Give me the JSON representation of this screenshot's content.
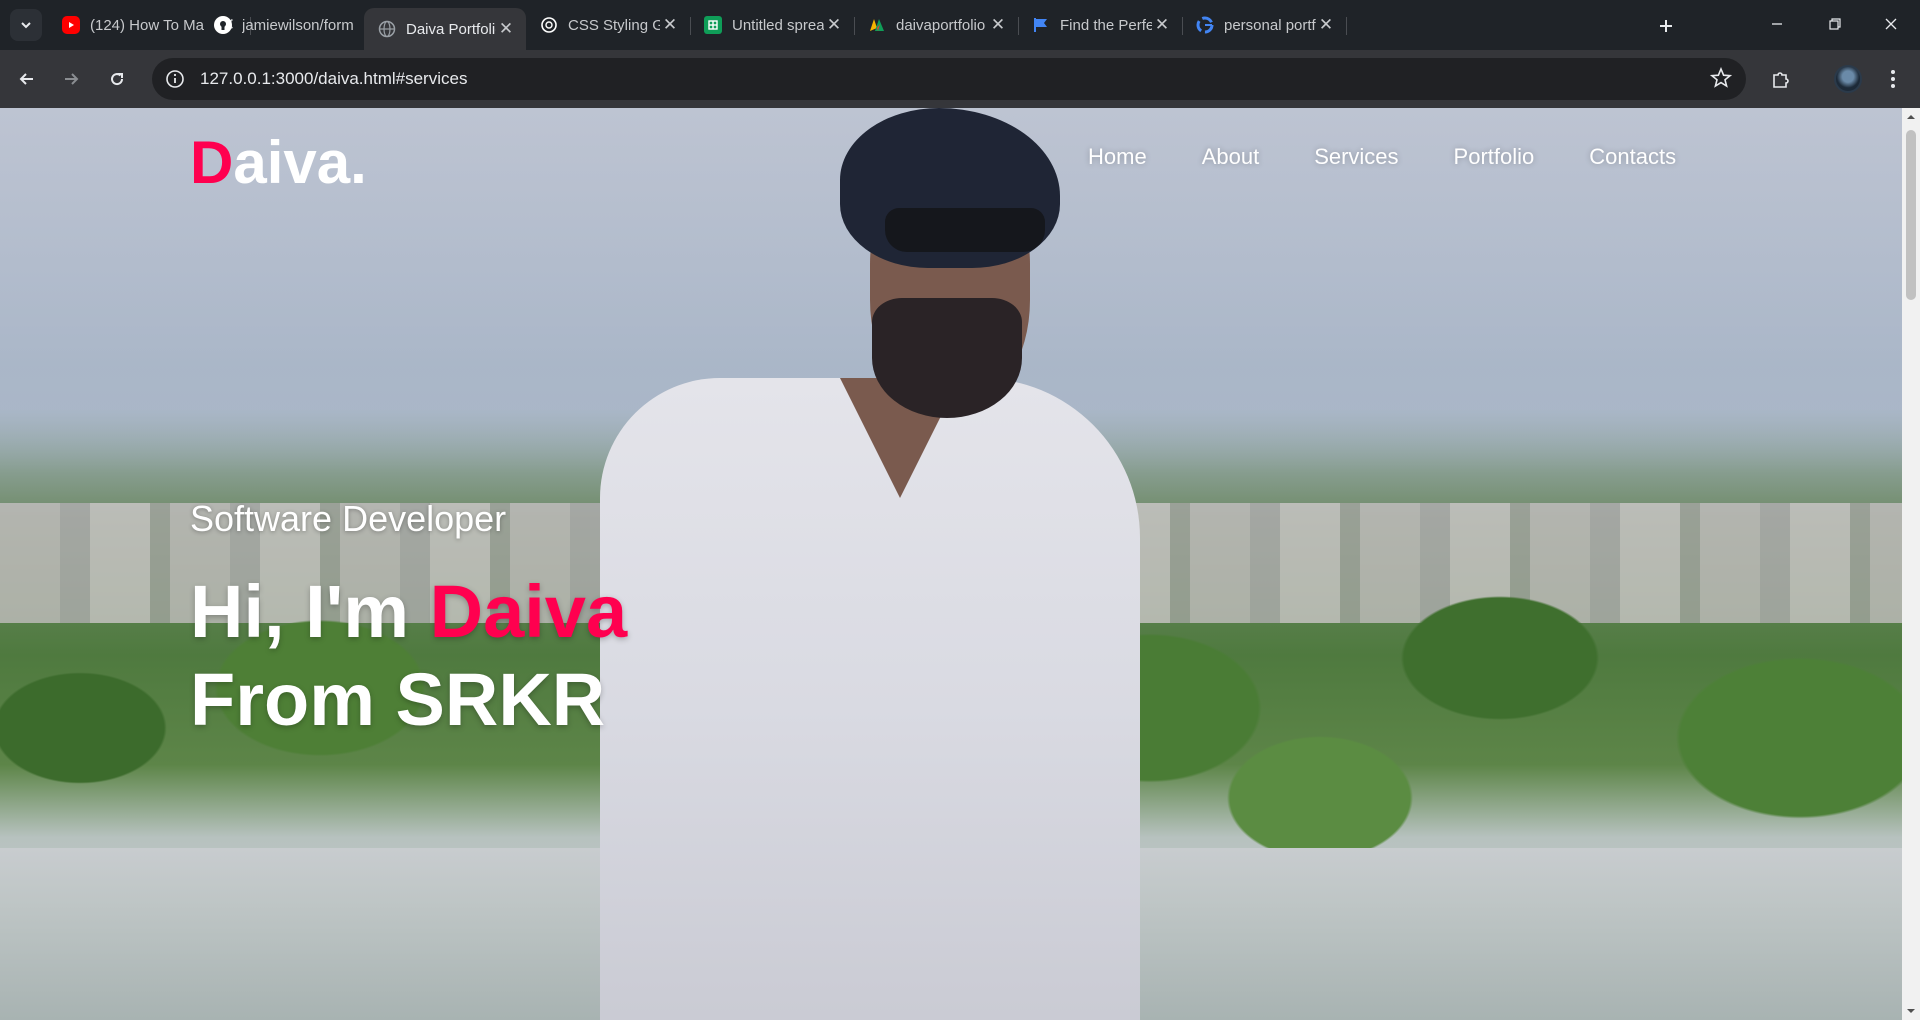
{
  "browser": {
    "tabs": [
      {
        "title": "(124) How To Ma",
        "icon": "youtube-icon",
        "color": "#ff0000"
      },
      {
        "title": "jamiewilson/form",
        "icon": "github-icon",
        "color": "#ffffff"
      },
      {
        "title": "Daiva Portfolio",
        "icon": "globe-icon",
        "color": "#9aa0a6",
        "active": true
      },
      {
        "title": "CSS Styling Guid",
        "icon": "openai-icon",
        "color": "#ffffff"
      },
      {
        "title": "Untitled spreads",
        "icon": "sheets-icon",
        "color": "#0f9d58"
      },
      {
        "title": "daivaportfolio -",
        "icon": "vercel-icon",
        "color": "#f4b400"
      },
      {
        "title": "Find the Perfect",
        "icon": "flag-icon",
        "color": "#4285f4"
      },
      {
        "title": "personal portfoli",
        "icon": "google-icon",
        "color": "#4285f4"
      }
    ],
    "url": "127.0.0.1:3000/daiva.html#services"
  },
  "site": {
    "logo_accent": "D",
    "logo_rest": "aiva.",
    "nav": [
      "Home",
      "About",
      "Services",
      "Portfolio",
      "Contacts"
    ],
    "subtitle": "Software Developer",
    "greeting": "Hi, I'm ",
    "name": "Daiva",
    "tagline": "From SRKR",
    "accent_color": "#ff004f"
  }
}
